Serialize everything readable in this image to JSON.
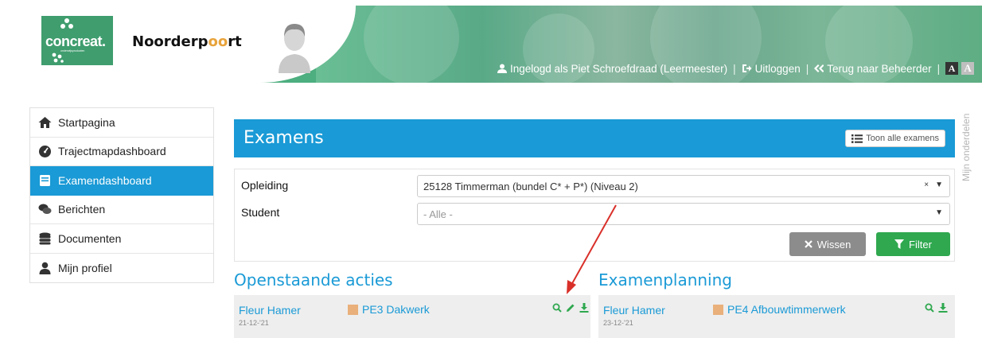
{
  "header": {
    "brand_concreat": "concreat.",
    "brand_concreat_sub": "onderwijsproducten",
    "brand_noord_pre": "Noorderp",
    "brand_noord_oo": "oo",
    "brand_noord_post": "rt",
    "logged_in_text": "Ingelogd als Piet Schroefdraad (Leermeester)",
    "logout_label": "Uitloggen",
    "back_label": "Terug naar Beheerder",
    "font_small": "A",
    "font_large": "A",
    "separator": "|",
    "bg_color": "#4dae7f"
  },
  "sidebar": {
    "items": [
      {
        "label": "Startpagina",
        "icon": "home-icon"
      },
      {
        "label": "Trajectmapdashboard",
        "icon": "dashboard-icon"
      },
      {
        "label": "Examendashboard",
        "icon": "book-icon",
        "active": true
      },
      {
        "label": "Berichten",
        "icon": "chat-icon"
      },
      {
        "label": "Documenten",
        "icon": "database-icon"
      },
      {
        "label": "Mijn profiel",
        "icon": "user-icon"
      }
    ],
    "active_color": "#1a9ad6"
  },
  "side_vertical_label": "Mijn onderdelen",
  "exams": {
    "title": "Examens",
    "show_all_label": "Toon alle examens"
  },
  "filter": {
    "opleiding_label": "Opleiding",
    "opleiding_value": "25128 Timmerman (bundel C* + P*) (Niveau 2)",
    "clear_symbol": "×",
    "dropdown_symbol": "▼",
    "student_label": "Student",
    "student_placeholder": "- Alle -",
    "wissen_label": "Wissen",
    "filter_label": "Filter"
  },
  "openstaande": {
    "title": "Openstaande acties",
    "rows": [
      {
        "student": "Fleur Hamer",
        "date": "21-12-'21",
        "task": "PE3 Dakwerk"
      }
    ]
  },
  "planning": {
    "title": "Examenplanning",
    "rows": [
      {
        "student": "Fleur Hamer",
        "date": "23-12-'21",
        "task": "PE4 Afbouwtimmerwerk"
      }
    ]
  },
  "colors": {
    "accent_blue": "#1a9ad6",
    "green": "#2fa84f",
    "gray_button": "#8c8c8c",
    "annotation_arrow": "#d9302a"
  }
}
